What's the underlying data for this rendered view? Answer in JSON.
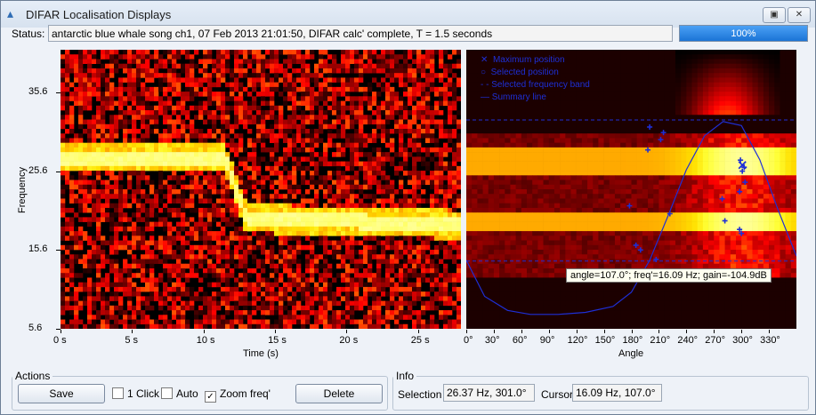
{
  "window": {
    "title": "DIFAR Localisation Displays",
    "controls": [
      "restore",
      "close"
    ]
  },
  "status": {
    "label": "Status:",
    "text": "antarctic blue whale song ch1, 07 Feb 2013 21:01:50, DIFAR calc' complete, T = 1.5 seconds",
    "progress_text": "100%",
    "progress": 1.0
  },
  "chart_data": [
    {
      "type": "heatmap",
      "ylabel": "Frequency",
      "xlabel": "Time (s)",
      "y_ticks": [
        "35.6",
        "25.6",
        "15.6",
        "5.6"
      ],
      "x_ticks": [
        "0 s",
        "5 s",
        "10 s",
        "15 s",
        "20 s",
        "25 s"
      ],
      "xlim": [
        0,
        28
      ],
      "ylim": [
        5.6,
        41
      ],
      "tonal_contour": {
        "t": [
          0,
          11.5,
          13.0,
          28
        ],
        "f": [
          27.3,
          27.3,
          19.6,
          18.8
        ]
      }
    },
    {
      "type": "heatmap",
      "xlabel": "Angle",
      "x_ticks": [
        "0°",
        "30°",
        "60°",
        "90°",
        "120°",
        "150°",
        "180°",
        "210°",
        "240°",
        "270°",
        "300°",
        "330°"
      ],
      "xlim": [
        0,
        360
      ],
      "ylim": [
        5.6,
        41
      ],
      "legend": [
        "Maximum position",
        "Selected position",
        "Selected frequency band",
        "Summary line"
      ],
      "legend_placement": "top-left",
      "frequency_band": [
        14.2,
        32.1
      ],
      "maximum_position": {
        "angle": 301,
        "freq": 26.37
      },
      "peaks": [
        {
          "angle": 200,
          "freq": 31.2
        },
        {
          "angle": 215,
          "freq": 30.5
        },
        {
          "angle": 212,
          "freq": 29.6
        },
        {
          "angle": 198,
          "freq": 28.3
        },
        {
          "angle": 178,
          "freq": 21.2
        },
        {
          "angle": 222,
          "freq": 20.2
        },
        {
          "angle": 185,
          "freq": 16.2
        },
        {
          "angle": 190,
          "freq": 15.6
        },
        {
          "angle": 207,
          "freq": 14.4
        },
        {
          "angle": 279,
          "freq": 22.1
        },
        {
          "angle": 282,
          "freq": 19.3
        },
        {
          "angle": 298,
          "freq": 18.2
        },
        {
          "angle": 300,
          "freq": 17.7
        },
        {
          "angle": 298,
          "freq": 23.0
        },
        {
          "angle": 304,
          "freq": 24.2
        },
        {
          "angle": 301,
          "freq": 25.6
        },
        {
          "angle": 303,
          "freq": 26.1
        },
        {
          "angle": 299,
          "freq": 27.0
        }
      ],
      "summary_line": {
        "angle": [
          0,
          20,
          45,
          70,
          100,
          130,
          160,
          180,
          200,
          220,
          240,
          260,
          280,
          300,
          320,
          340,
          360
        ],
        "level": [
          0.3,
          0.12,
          0.05,
          0.03,
          0.03,
          0.04,
          0.07,
          0.14,
          0.3,
          0.52,
          0.75,
          0.92,
          0.99,
          0.97,
          0.8,
          0.55,
          0.32
        ]
      },
      "cursor_tooltip": "angle=107.0°; freq'=16.09 Hz; gain=-104.9dB"
    }
  ],
  "actions": {
    "group_label": "Actions",
    "save_label": "Save",
    "one_click_label": "1 Click",
    "one_click_checked": false,
    "auto_label": "Auto",
    "auto_checked": false,
    "zoom_label": "Zoom freq'",
    "zoom_checked": true,
    "delete_label": "Delete"
  },
  "info": {
    "group_label": "Info",
    "selection_label": "Selection",
    "selection_value": "26.37 Hz, 301.0°",
    "cursor_label": "Cursor",
    "cursor_value": "16.09 Hz, 107.0°"
  }
}
